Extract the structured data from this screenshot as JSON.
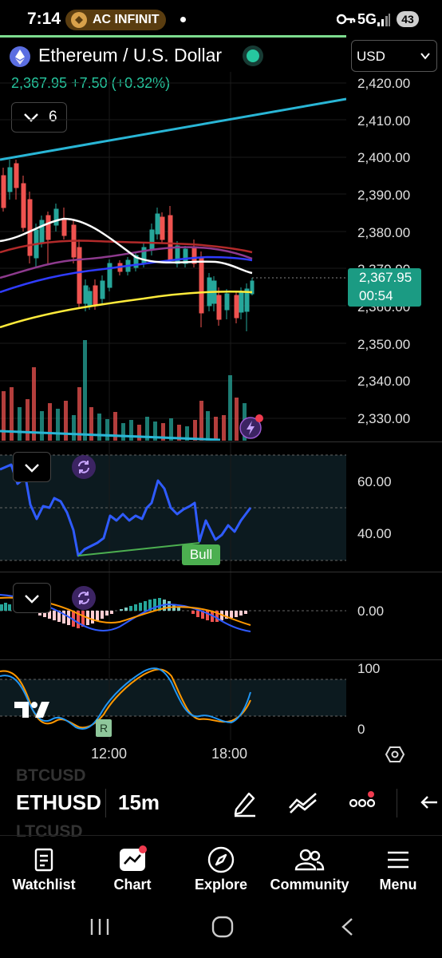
{
  "status_bar": {
    "time": "7:14",
    "notification_text": "AC INFINIT",
    "network": "5G",
    "battery": "43"
  },
  "header": {
    "pair_title": "Ethereum / U.S. Dollar",
    "price_line": "2,367.95 +7.50 (+0.32%)",
    "indicator_count": "6",
    "currency": "USD"
  },
  "price_axis": [
    "2,420.00",
    "2,410.00",
    "2,400.00",
    "2,390.00",
    "2,380.00",
    "2,370.00",
    "2,360.00",
    "2,350.00",
    "2,340.00",
    "2,330.00"
  ],
  "last_price_tag": {
    "price": "2,367.95",
    "countdown": "00:54"
  },
  "rsi": {
    "axis": [
      "60.00",
      "40.00"
    ],
    "divergence_label": "Bull"
  },
  "macd": {
    "axis": [
      "0.00"
    ]
  },
  "stoch": {
    "axis": [
      "100",
      "0"
    ],
    "marker": "R"
  },
  "time_axis": [
    "12:00",
    "18:00"
  ],
  "toolbar": {
    "prev_symbol": "BTCUSD",
    "symbol": "ETHUSD",
    "next_symbol": "LTCUSD",
    "timeframe": "15m"
  },
  "bottom_nav": [
    "Watchlist",
    "Chart",
    "Explore",
    "Community",
    "Menu"
  ],
  "colors": {
    "up": "#26a69a",
    "down": "#ef5350",
    "accent": "#26c79f",
    "trend": "#29b6d6"
  }
}
